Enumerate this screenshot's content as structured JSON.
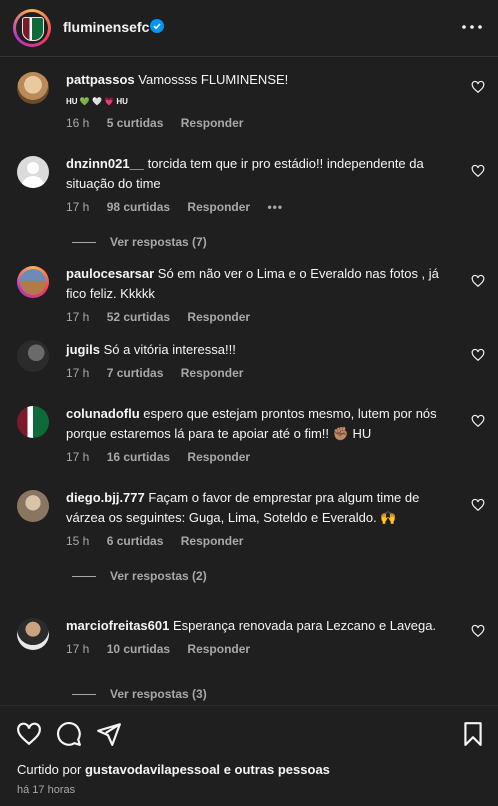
{
  "header": {
    "username": "fluminensefc"
  },
  "comments": [
    {
      "user": "pattpassos",
      "text": "Vamossss FLUMINENSE!",
      "emoji_line": "HU 💚 🤍 💗 HU",
      "time": "16 h",
      "likes": "5 curtidas",
      "reply": "Responder"
    },
    {
      "user": "dnzinn021__",
      "text": "torcida tem que ir pro estádio!! independente da situação do time",
      "time": "17 h",
      "likes": "98 curtidas",
      "reply": "Responder",
      "more": "•••",
      "view_replies": "Ver respostas (7)"
    },
    {
      "user": "paulocesarsar",
      "text": "Só em não ver o Lima e o Everaldo nas fotos , já fico feliz. Kkkkk",
      "time": "17 h",
      "likes": "52 curtidas",
      "reply": "Responder"
    },
    {
      "user": "jugils",
      "text": "Só a vitória interessa!!!",
      "time": "17 h",
      "likes": "7 curtidas",
      "reply": "Responder"
    },
    {
      "user": "colunadoflu",
      "text": "espero que estejam prontos mesmo, lutem por nós porque estaremos lá para te apoiar até o fim!! ✊🏽 HU",
      "time": "17 h",
      "likes": "16 curtidas",
      "reply": "Responder"
    },
    {
      "user": "diego.bjj.777",
      "text": "Façam o favor de emprestar pra algum time de várzea os seguintes: Guga, Lima, Soteldo e Everaldo. 🙌",
      "time": "15 h",
      "likes": "6 curtidas",
      "reply": "Responder",
      "view_replies": "Ver respostas (2)"
    },
    {
      "user": "marciofreitas601",
      "text": "Esperança renovada para Lezcano e Lavega.",
      "time": "17 h",
      "likes": "10 curtidas",
      "reply": "Responder",
      "view_replies": "Ver respostas (3)"
    }
  ],
  "footer": {
    "liked_by_prefix": "Curtido por",
    "liked_by_user": "gustavodavilapessoal",
    "liked_by_suffix": "e outras pessoas",
    "time_ago": "há 17 horas"
  },
  "colors": {
    "background": "#1f1f1f",
    "muted": "#a8a8a8",
    "verified": "#0095f6"
  }
}
